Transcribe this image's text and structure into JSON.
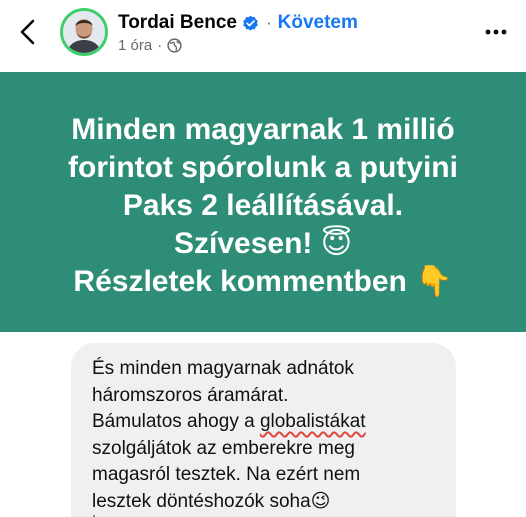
{
  "header": {
    "author_name": "Tordai Bence",
    "separator": "·",
    "follow_label": "Követem",
    "timestamp": "1 óra",
    "meta_separator": "·",
    "icons": [
      "back-chevron-icon",
      "verified-badge-icon",
      "globe-icon",
      "more-options-icon"
    ],
    "colors": {
      "follow": "#1877f2",
      "verified": "#1877f2",
      "avatar_ring": "#3ecf6b"
    }
  },
  "banner": {
    "background": "#2e8d76",
    "lines": [
      "Minden magyarnak 1 millió",
      "forintot spórolunk a putyini",
      "Paks 2 leállításával.",
      "Szívesen! 😇",
      "Részletek kommentben 👇"
    ]
  },
  "comment": {
    "lines": [
      "És minden magyarnak adnátok",
      "háromszoros áramárat.",
      "Bámulatos ahogy a ",
      "globalistákat",
      "szolgáljátok az emberekre meg",
      "magasról tesztek. Na ezért nem",
      "lesztek döntéshozók soha😉"
    ]
  }
}
